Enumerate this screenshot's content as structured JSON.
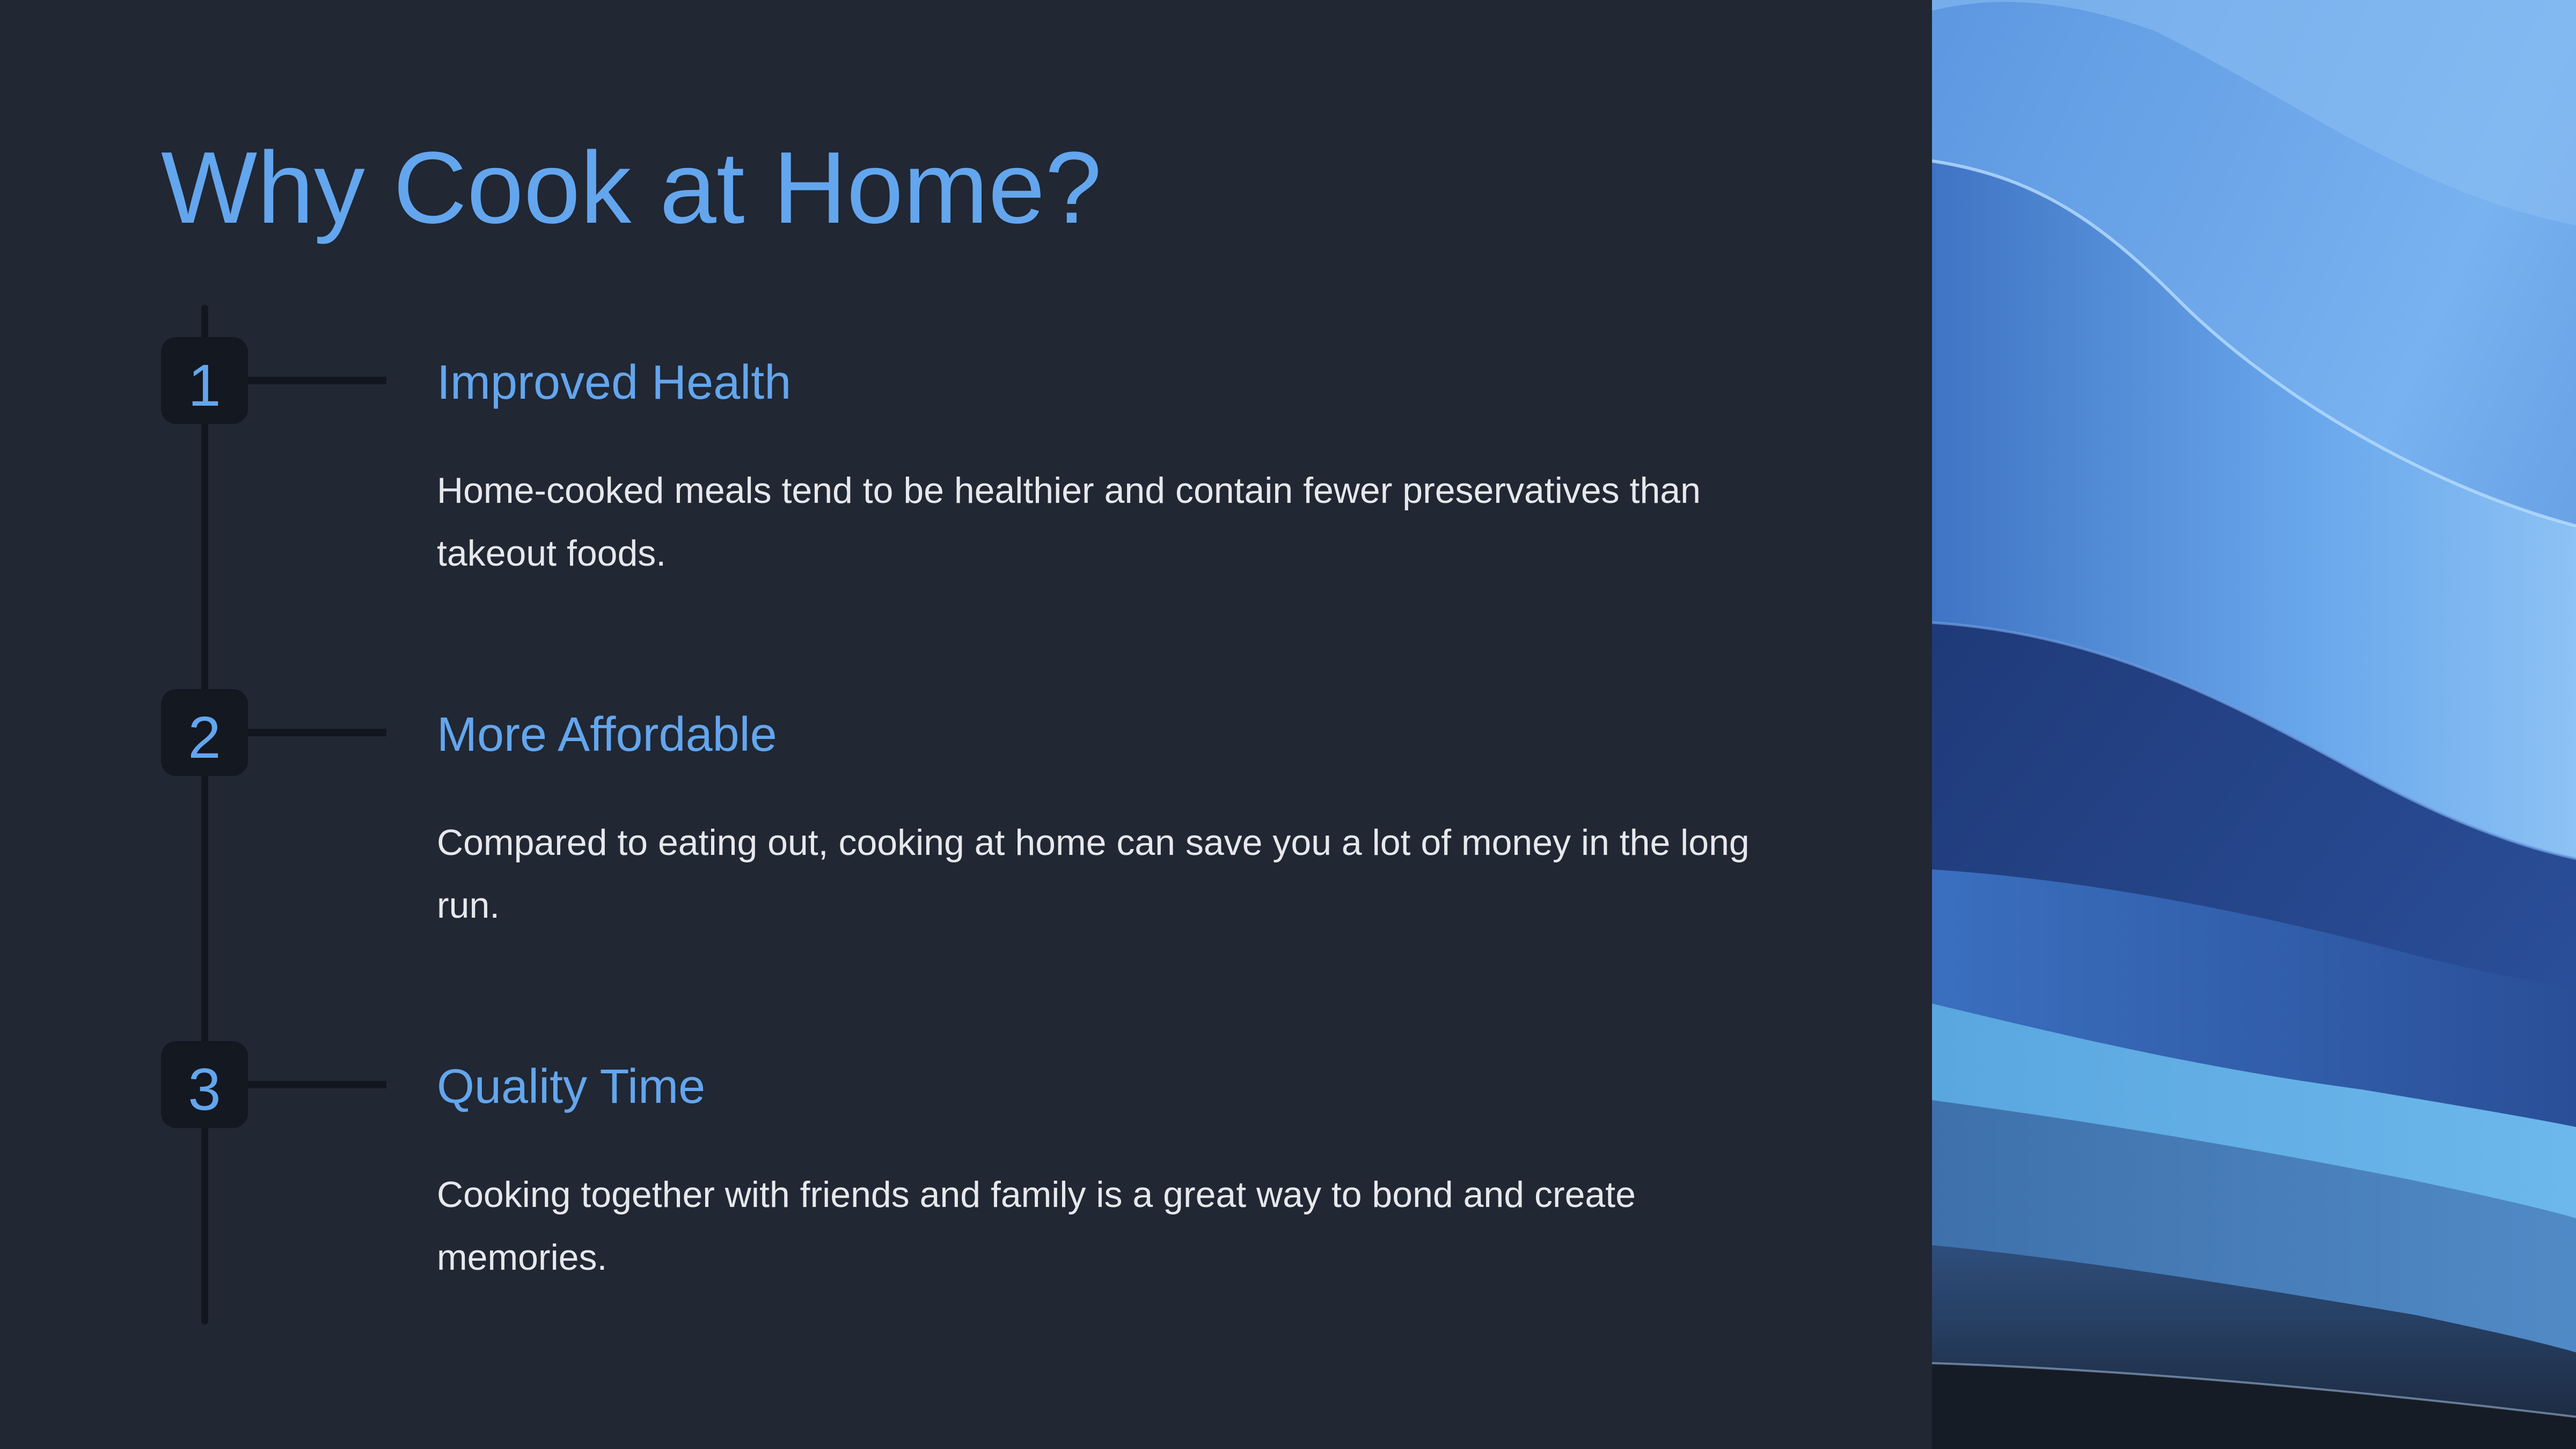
{
  "title": "Why Cook at Home?",
  "steps": [
    {
      "number": "1",
      "heading": "Improved Health",
      "text": "Home-cooked meals tend to be healthier and contain fewer preservatives than takeout foods."
    },
    {
      "number": "2",
      "heading": "More Affordable",
      "text": "Compared to eating out, cooking at home can save you a lot of money in the long run."
    },
    {
      "number": "3",
      "heading": "Quality Time",
      "text": "Cooking together with friends and family is a great way to bond and create memories."
    }
  ],
  "colors": {
    "background": "#212733",
    "accent": "#63a6ee",
    "body_text": "#e6e8ec",
    "timeline": "#12161e"
  }
}
